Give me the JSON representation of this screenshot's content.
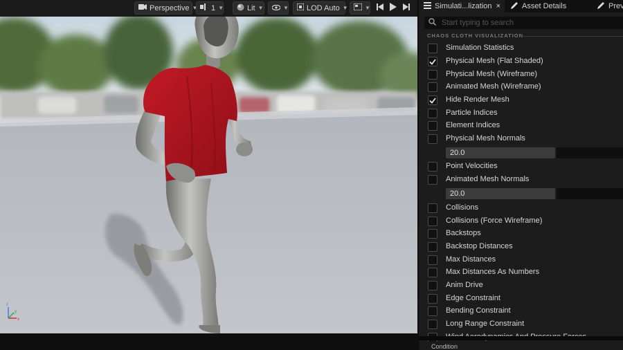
{
  "toolbar": {
    "perspective_label": "Perspective",
    "camera_speed_label": "1",
    "lit_label": "Lit",
    "lod_label": "LOD Auto",
    "icons": [
      "perspective-camera-icon",
      "camera-speed-icon",
      "lit-sphere-icon",
      "show-eye-icon",
      "lod-icon",
      "screen-settings-icon",
      "skip-back-icon",
      "play-icon",
      "skip-forward-icon"
    ]
  },
  "tabs": {
    "simulation_label": "Simulati...lization",
    "close_glyph": "×",
    "asset_details_label": "Asset Details",
    "preview_label": "Previ"
  },
  "search": {
    "placeholder": "Start typing to search"
  },
  "section": {
    "title": "CHAOS CLOTH VISUALIZATION"
  },
  "options": [
    {
      "label": "Simulation Statistics",
      "checked": false
    },
    {
      "label": "Physical Mesh (Flat Shaded)",
      "checked": true
    },
    {
      "label": "Physical Mesh (Wireframe)",
      "checked": false
    },
    {
      "label": "Animated Mesh (Wireframe)",
      "checked": false
    },
    {
      "label": "Hide Render Mesh",
      "checked": true
    },
    {
      "label": "Particle Indices",
      "checked": false
    },
    {
      "label": "Element Indices",
      "checked": false
    },
    {
      "label": "Physical Mesh Normals",
      "checked": false
    },
    {
      "label": "Point Velocities",
      "checked": false
    },
    {
      "label": "Animated Mesh Normals",
      "checked": false
    },
    {
      "label": "Collisions",
      "checked": false
    },
    {
      "label": "Collisions (Force Wireframe)",
      "checked": false
    },
    {
      "label": "Backstops",
      "checked": false
    },
    {
      "label": "Backstop Distances",
      "checked": false
    },
    {
      "label": "Max Distances",
      "checked": false
    },
    {
      "label": "Max Distances As Numbers",
      "checked": false
    },
    {
      "label": "Anim Drive",
      "checked": false
    },
    {
      "label": "Edge Constraint",
      "checked": false
    },
    {
      "label": "Bending Constraint",
      "checked": false
    },
    {
      "label": "Long Range Constraint",
      "checked": false
    },
    {
      "label": "Wind Aerodynamics And Pressure Forces",
      "checked": false
    }
  ],
  "normals_scale": {
    "physical_mesh_normals": "20.0",
    "animated_mesh_normals": "20.0"
  },
  "bottom_panel": {
    "condition_label": "Condition"
  },
  "colors": {
    "shirt": "#b3151f",
    "mannequin": "#9a9a96",
    "floor": "#b9bcc2",
    "accent": "#2f7be0"
  }
}
